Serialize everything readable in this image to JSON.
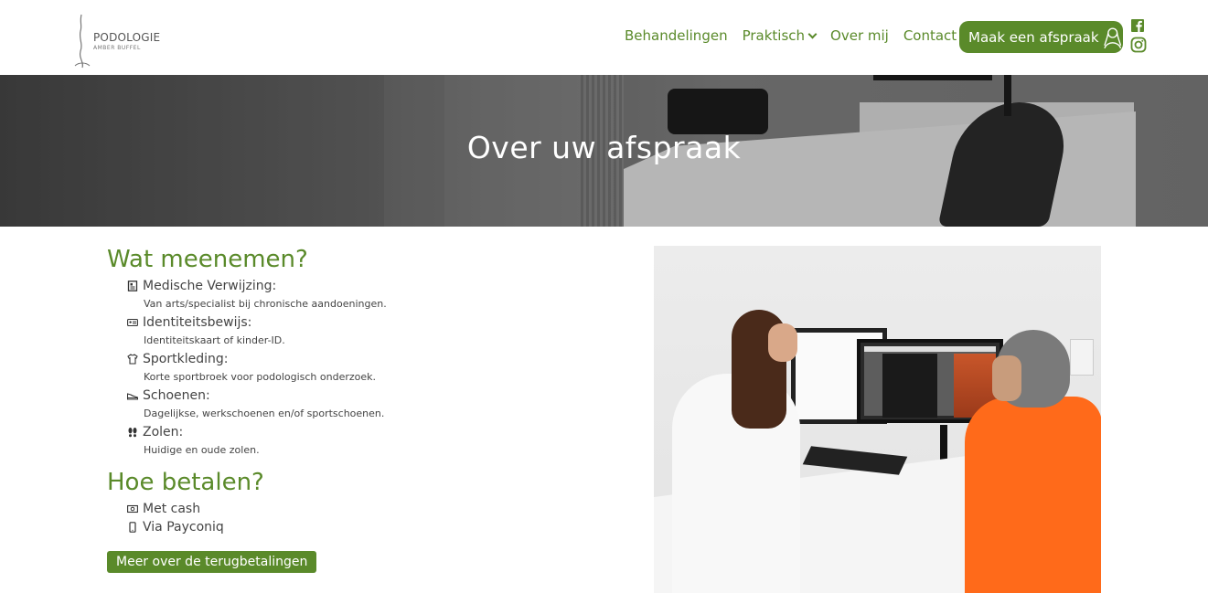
{
  "brand": {
    "name": "PODOLOGIE",
    "sub": "AMBER BUFFEL"
  },
  "nav": {
    "items": [
      {
        "label": "Behandelingen"
      },
      {
        "label": "Praktisch"
      },
      {
        "label": "Over mij"
      },
      {
        "label": "Contact"
      }
    ],
    "cta_label": "Maak een afspraak"
  },
  "social": [
    "facebook-icon",
    "instagram-icon"
  ],
  "hero": {
    "title": "Over uw afspraak"
  },
  "bring": {
    "title": "Wat meenemen?",
    "items": [
      {
        "icon": "document-icon",
        "title": "Medische Verwijzing:",
        "desc": "Van arts/specialist bij chronische aandoeningen."
      },
      {
        "icon": "id-card-icon",
        "title": "Identiteitsbewijs:",
        "desc": "Identiteitskaart of kinder-ID."
      },
      {
        "icon": "shirt-icon",
        "title": "Sportkleding:",
        "desc": "Korte sportbroek voor podologisch onderzoek."
      },
      {
        "icon": "shoe-icon",
        "title": "Schoenen:",
        "desc": "Dagelijkse, werkschoenen en/of sportschoenen."
      },
      {
        "icon": "footprints-icon",
        "title": "Zolen:",
        "desc": "Huidige en oude zolen."
      }
    ]
  },
  "pay": {
    "title": "Hoe betalen?",
    "items": [
      {
        "icon": "cash-icon",
        "title": "Met cash"
      },
      {
        "icon": "phone-icon",
        "title": "Via Payconiq"
      }
    ],
    "button_label": "Meer over de terugbetalingen"
  },
  "colors": {
    "accent": "#5a8a2a",
    "text": "#444444"
  }
}
